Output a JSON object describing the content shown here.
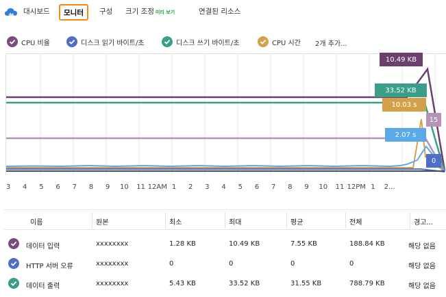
{
  "tabs": {
    "dashboard": "대시보드",
    "monitor": "모니터",
    "config": "구성",
    "scale": "크기 조정",
    "scale_badge": "미리 보기",
    "linked": "연결된 리소스"
  },
  "legend": {
    "items": [
      {
        "label": "CPU 비율",
        "color": "#7b4b7f"
      },
      {
        "label": "디스크 읽기 바이트/초",
        "color": "#4f6fc7"
      },
      {
        "label": "디스크 쓰기 바이트/초",
        "color": "#3a9e8a"
      },
      {
        "label": "CPU 시간",
        "color": "#d4a14a"
      }
    ],
    "more": "2개 추가..."
  },
  "chart_data": {
    "type": "line",
    "x": [
      "3",
      "4",
      "5",
      "6",
      "7",
      "8",
      "9",
      "10",
      "11",
      "12AM",
      "1",
      "2",
      "3",
      "4",
      "5",
      "6",
      "7",
      "8",
      "9",
      "10",
      "11",
      "12PM",
      "1",
      "2..."
    ],
    "tags": [
      {
        "label": "10.49 KB",
        "color": "#6b3f6e"
      },
      {
        "label": "33.52 KB",
        "color": "#3a9e8a"
      },
      {
        "label": "10.03 s",
        "color": "#d4a14a"
      },
      {
        "label": "15",
        "color": "#b592b8"
      },
      {
        "label": "2.07 s",
        "color": "#5aa9ea"
      },
      {
        "label": "0",
        "color": "#4f6fc7"
      }
    ],
    "grid": true
  },
  "table": {
    "headers": [
      "이름",
      "원본",
      "최소",
      "최대",
      "평균",
      "전체",
      "경고..."
    ],
    "rows": [
      {
        "name": "데이터 입력",
        "source": "xxxxxxxx",
        "min": "1.28 KB",
        "max": "10.49 KB",
        "avg": "7.55 KB",
        "total": "188.84 KB",
        "alert": "해당 없음",
        "color": "#7b4b7f"
      },
      {
        "name": "HTTP 서버 오류",
        "source": "xxxxxxxx",
        "min": "0",
        "max": "0",
        "avg": "0",
        "total": "0",
        "alert": "해당 없음",
        "color": "#4f6fc7"
      },
      {
        "name": "데이터 출력",
        "source": "xxxxxxxx",
        "min": "5.43 KB",
        "max": "33.52 KB",
        "avg": "31.55 KB",
        "total": "788.79 KB",
        "alert": "해당 없음",
        "color": "#3a9e8a"
      }
    ]
  }
}
